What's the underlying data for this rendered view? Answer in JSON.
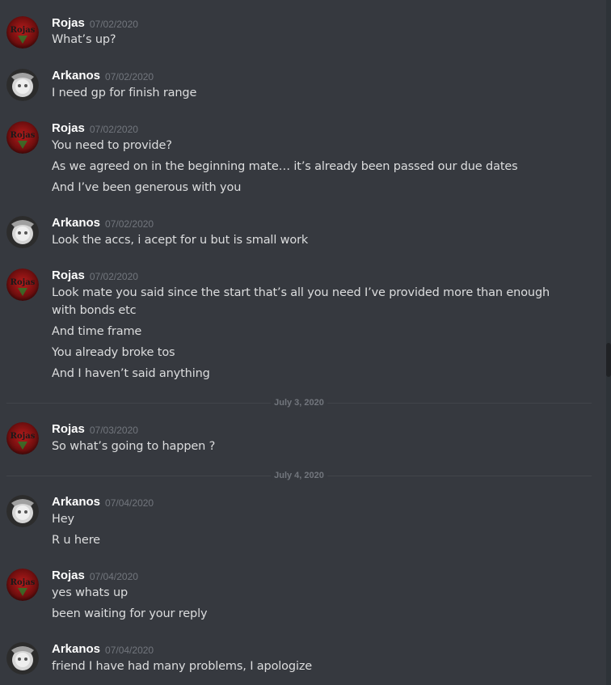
{
  "users": {
    "rojas": {
      "name": "Rojas",
      "avatar_text": "Rojas",
      "avatar_color": "#7a1212"
    },
    "arkanos": {
      "name": "Arkanos",
      "avatar_color": "#d8d8d8"
    }
  },
  "messages": [
    {
      "author": "Rojas",
      "timestamp": "07/02/2020",
      "lines": [
        "What’s up?"
      ]
    },
    {
      "author": "Arkanos",
      "timestamp": "07/02/2020",
      "lines": [
        "I need gp for finish range"
      ]
    },
    {
      "author": "Rojas",
      "timestamp": "07/02/2020",
      "lines": [
        "You need to provide?",
        "As we agreed on in the beginning mate… it’s already been passed our due dates",
        "And I’ve been generous with you"
      ]
    },
    {
      "author": "Arkanos",
      "timestamp": "07/02/2020",
      "lines": [
        "Look the accs, i acept for u but is small work"
      ]
    },
    {
      "author": "Rojas",
      "timestamp": "07/02/2020",
      "lines": [
        "Look mate you said since the start that’s all you need I’ve provided more than enough with bonds etc",
        "And time frame",
        "You already broke tos",
        "And I haven’t said anything"
      ]
    },
    {
      "author": "Rojas",
      "timestamp": "07/03/2020",
      "lines": [
        "So what’s going to happen ?"
      ]
    },
    {
      "author": "Arkanos",
      "timestamp": "07/04/2020",
      "lines": [
        "Hey",
        "R u here"
      ]
    },
    {
      "author": "Rojas",
      "timestamp": "07/04/2020",
      "lines": [
        "yes whats up",
        "been waiting for your reply"
      ]
    },
    {
      "author": "Arkanos",
      "timestamp": "07/04/2020",
      "lines": [
        "friend I have had many problems, I apologize"
      ]
    }
  ],
  "dividers": [
    "July 3, 2020",
    "July 4, 2020"
  ],
  "colors": {
    "background": "#36393f",
    "author": "#ffffff",
    "text": "#dcddde",
    "timestamp": "#72767d"
  }
}
